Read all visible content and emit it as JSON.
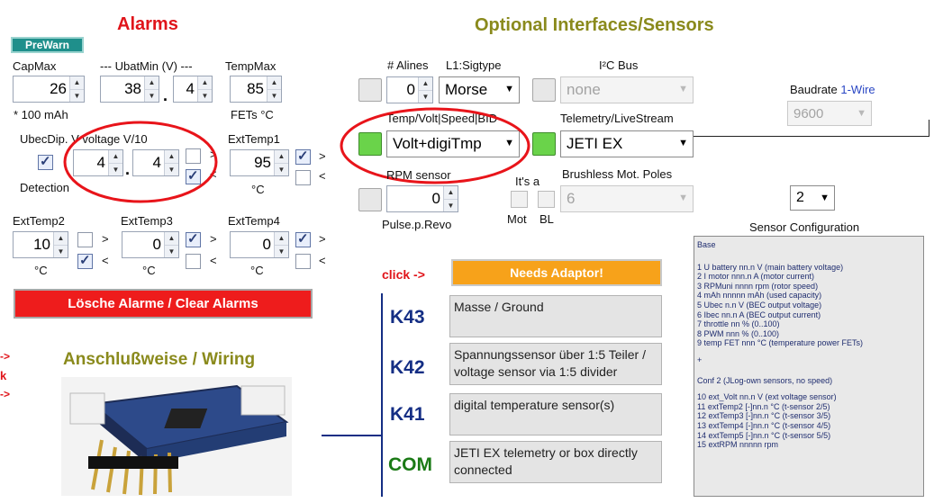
{
  "alarms": {
    "title": "Alarms",
    "prewarn_label": "PreWarn",
    "capmax": {
      "label": "CapMax",
      "value": "26",
      "unit": "* 100 mAh"
    },
    "ubatmin": {
      "label": "--- UbatMin (V) ---",
      "value_int": "38",
      "value_dec": "4"
    },
    "tempmax": {
      "label": "TempMax",
      "value": "85",
      "unit": "FETs °C"
    },
    "ubecdip": {
      "label": "UbecDip. V voltage V/10",
      "value_int": "4",
      "value_dec": "4",
      "detection_label": "Detection"
    },
    "exttemp1": {
      "label": "ExtTemp1",
      "value": "95",
      "unit": "°C"
    },
    "exttemp2": {
      "label": "ExtTemp2",
      "value": "10",
      "unit": "°C"
    },
    "exttemp3": {
      "label": "ExtTemp3",
      "value": "0",
      "unit": "°C"
    },
    "exttemp4": {
      "label": "ExtTemp4",
      "value": "0",
      "unit": "°C"
    },
    "gt": ">",
    "lt": "<",
    "clear_button": "Lösche Alarme / Clear Alarms"
  },
  "wiring": {
    "title": "Anschlußweise / Wiring",
    "left_marks": [
      "->",
      "k",
      "->"
    ]
  },
  "interfaces": {
    "title": "Optional Interfaces/Sensors",
    "alines_label": "# Alines",
    "l1_label": "L1:Sigtype",
    "alines_value": "0",
    "sigtype_value": "Morse",
    "i2c_label": "I²C Bus",
    "i2c_value": "none",
    "baudrate_label_a": "Baudrate ",
    "baudrate_label_b": "1-Wire",
    "baudrate_value": "9600",
    "temp_label": "Temp/Volt|Speed|BID",
    "temp_value": "Volt+digiTmp",
    "telemetry_label": "Telemetry/LiveStream",
    "telemetry_value": "JETI EX",
    "rpm_label": "RPM sensor",
    "rpm_value": "0",
    "pulse_label": "Pulse.p.Revo",
    "itsa_label": "It's a",
    "mot_label": "Mot",
    "bl_label": "BL",
    "poles_label": "Brushless Mot. Poles",
    "poles_value": "6",
    "sensor_config_value": "2",
    "sensor_config_label": "Sensor Configuration",
    "click_label": "click ->",
    "adaptor_button": "Needs Adaptor!"
  },
  "ports": [
    {
      "name": "K43",
      "desc": "Masse / Ground"
    },
    {
      "name": "K42",
      "desc": "Spannungssensor über 1:5 Teiler / voltage sensor via 1:5 divider"
    },
    {
      "name": "K41",
      "desc": "digital temperature sensor(s)"
    },
    {
      "name": "COM",
      "desc": "JETI EX telemetry or box directly connected"
    }
  ],
  "sensor_list": {
    "head": "Base",
    "base_lines": [
      "1 U battery nn.n V (main battery voltage)",
      "2 I motor   nnn.n A (motor current)",
      "3 RPMuni    nnnn rpm (rotor speed)",
      "4 mAh       nnnnn mAh (used capacity)",
      "5 Ubec     n.n V (BEC output voltage)",
      "6 Ibec     nn.n A (BEC output current)",
      "7 throttle  nn % (0..100)",
      "8 PWM      nnn % (0..100)",
      "9 temp FET  nnn °C (temperature power FETs)"
    ],
    "plus": "+",
    "conf2_head": "Conf 2 (JLog-own sensors, no speed)",
    "conf2_lines": [
      "10 ext_Volt nn.n V (ext voltage sensor)",
      "11 extTemp2 [-]nn.n °C (t-sensor 2/5)",
      "12 extTemp3 [-]nn.n °C (t-sensor 3/5)",
      "13 extTemp4 [-]nn.n °C (t-sensor 4/5)",
      "14 extTemp5 [-]nn.n °C (t-sensor 5/5)",
      "15 extRPM   nnnnn rpm"
    ]
  },
  "colors": {
    "alarm_red": "#e0141a",
    "olive": "#8a8a1c",
    "navy": "#142e84",
    "com_green": "#1b7a16",
    "orange": "#f7a21a"
  }
}
